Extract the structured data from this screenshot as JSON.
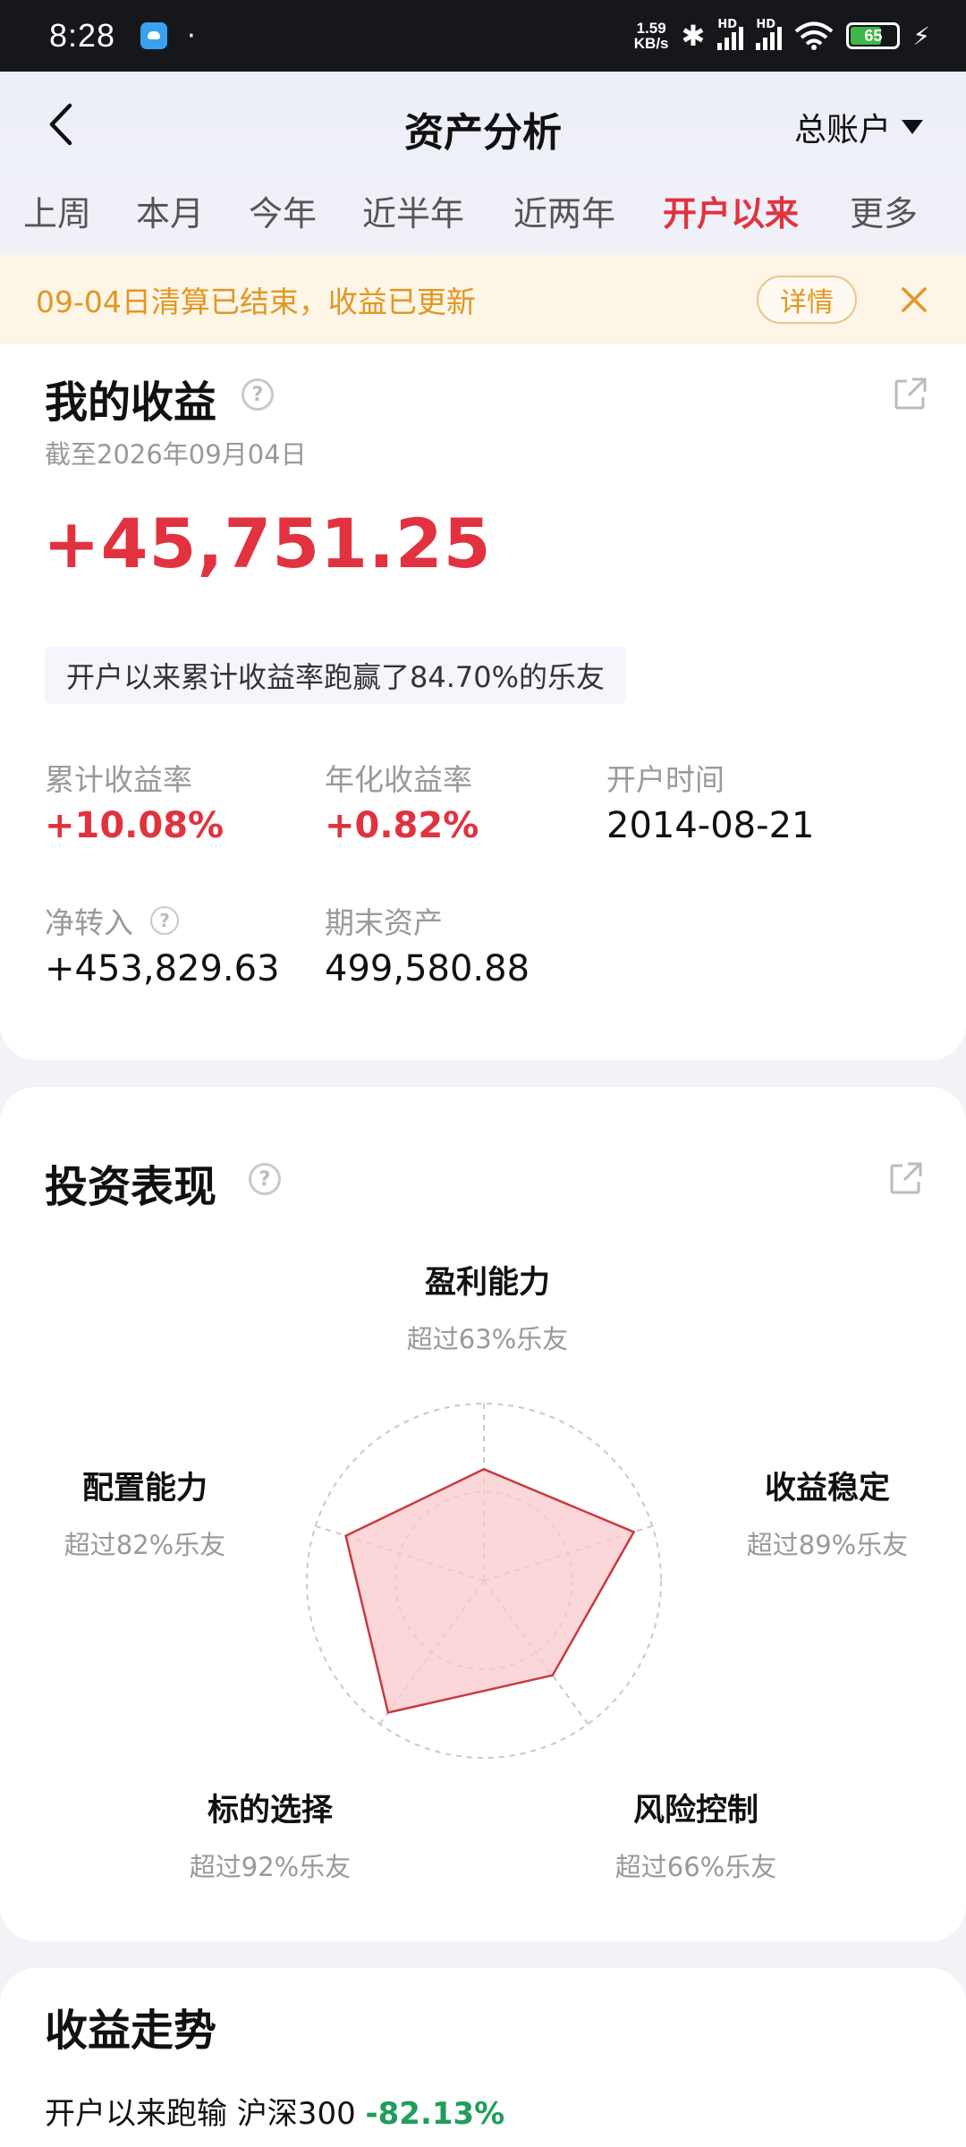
{
  "status_bar": {
    "time": "8:28",
    "dot": "·",
    "speed_top": "1.59",
    "speed_bottom": "KB/s",
    "hd": "HD",
    "battery": "65"
  },
  "header": {
    "title": "资产分析",
    "account_label": "总账户"
  },
  "tabs": [
    {
      "label": "上周"
    },
    {
      "label": "本月"
    },
    {
      "label": "今年"
    },
    {
      "label": "近半年"
    },
    {
      "label": "近两年"
    },
    {
      "label": "开户以来",
      "active": true
    },
    {
      "label": "更多"
    }
  ],
  "notice": {
    "text": "09-04日清算已结束，收益已更新",
    "detail_label": "详情"
  },
  "earnings": {
    "title": "我的收益",
    "as_of": "截至2026年09月04日",
    "total": "+45,751.25",
    "rank_text": "开户以来累计收益率跑赢了84.70%的乐友",
    "metrics": [
      {
        "label": "累计收益率",
        "value": "+10.08%"
      },
      {
        "label": "年化收益率",
        "value": "+0.82%"
      },
      {
        "label": "开户时间",
        "value": "2014-08-21"
      },
      {
        "label": "净转入",
        "value": "+453,829.63"
      },
      {
        "label": "期末资产",
        "value": "499,580.88"
      }
    ]
  },
  "performance": {
    "title": "投资表现",
    "dimensions": [
      {
        "label": "盈利能力",
        "sub": "超过63%乐友",
        "score": 63
      },
      {
        "label": "收益稳定",
        "sub": "超过89%乐友",
        "score": 89
      },
      {
        "label": "风险控制",
        "sub": "超过66%乐友",
        "score": 66
      },
      {
        "label": "标的选择",
        "sub": "超过92%乐友",
        "score": 92
      },
      {
        "label": "配置能力",
        "sub": "超过82%乐友",
        "score": 82
      }
    ],
    "colors": {
      "fill": "#f9c9cc",
      "stroke": "#c9393f"
    }
  },
  "trend": {
    "title": "收益走势",
    "sub_prefix": "开户以来跑输 沪深300",
    "sub_value": "-82.13%"
  },
  "icons": [
    "back-icon",
    "caret-down-icon",
    "close-icon",
    "help-icon",
    "share-icon"
  ]
}
